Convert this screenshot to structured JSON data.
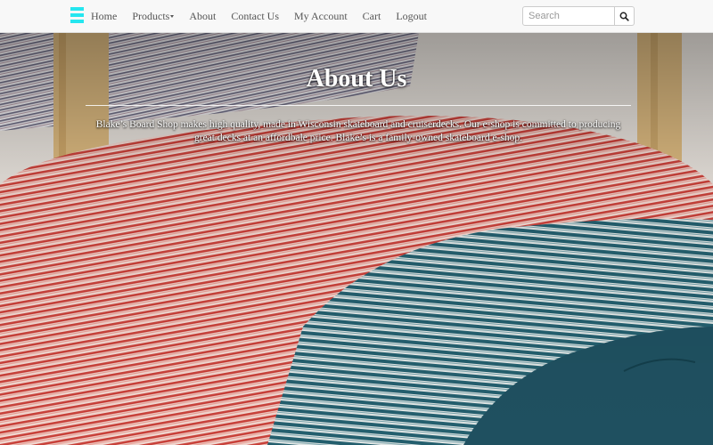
{
  "nav": {
    "logo_icon": "hamburger-logo-icon",
    "brand_color": "#25e6ef",
    "items": [
      {
        "label": "Home"
      },
      {
        "label": "Products",
        "dropdown": true
      },
      {
        "label": "About"
      },
      {
        "label": "Contact Us"
      },
      {
        "label": "My Account"
      },
      {
        "label": "Cart"
      },
      {
        "label": "Logout"
      }
    ],
    "search": {
      "placeholder": "Search",
      "value": "",
      "button_icon": "search-icon"
    }
  },
  "hero": {
    "title": "About Us",
    "text": "Blake’s Board Shop makes high quality, made in Wisconsin skateboard and cruiserdecks. Our e-shop is committed to producing great decks at an affordbale price. Blake’s is a family-owned skateboard e-shop.",
    "background": "stacked-skateboard-decks-photo",
    "colors": {
      "red_decks": "#c8413a",
      "teal_decks": "#245f6e",
      "wood": "#d9b77e"
    }
  }
}
